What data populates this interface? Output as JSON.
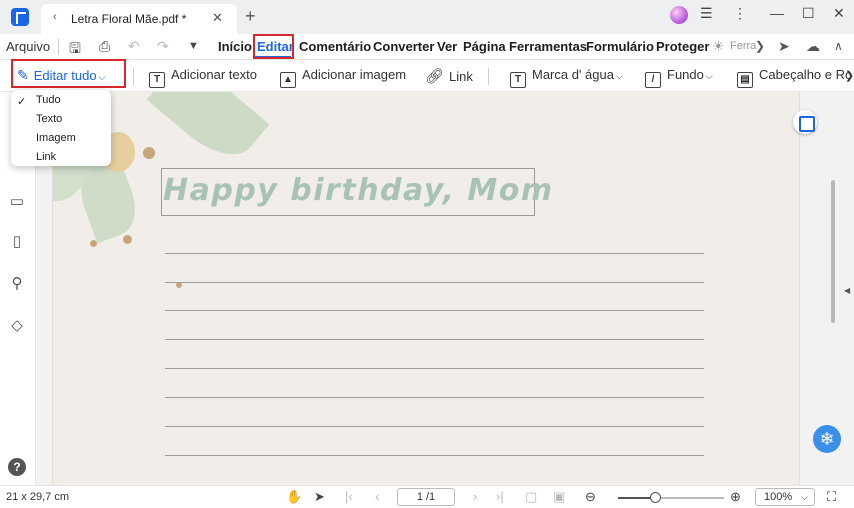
{
  "titlebar": {
    "tab_title": "Letra Floral Mãe.pdf *",
    "tab_close": "✕",
    "new_tab": "+",
    "window_controls": {
      "help": "☰",
      "more": "⋮",
      "minimize": "—",
      "maximize": "☐",
      "close": "✕"
    }
  },
  "menubar": {
    "file": "Arquivo",
    "items": [
      "Início",
      "Editar",
      "Comentário",
      "Converter",
      "Ver",
      "Página",
      "Ferramentas",
      "Formulário",
      "Proteger"
    ],
    "active": "Editar",
    "overflow_label": "Ferra"
  },
  "toolbar": {
    "edit_all": "Editar tudo",
    "add_text": "Adicionar texto",
    "add_image": "Adicionar imagem",
    "link": "Link",
    "watermark": "Marca d' água",
    "background": "Fundo",
    "header_footer": "Cabeçalho e Ro"
  },
  "dropdown": {
    "items": [
      "Tudo",
      "Texto",
      "Imagem",
      "Link"
    ],
    "selected": "Tudo"
  },
  "document": {
    "heading": "Happy birthday, Mom"
  },
  "statusbar": {
    "page_size": "21 x 29,7 cm",
    "page_indicator": "1 /1",
    "zoom_fraction": 0.35,
    "zoom_value": "100%"
  },
  "colors": {
    "accent": "#1a66e8",
    "highlight": "#d9272e",
    "heading_text": "#a8c2b4",
    "page_bg": "#f1eee9"
  },
  "icons": [
    "app-logo-icon",
    "print-icon",
    "undo-icon",
    "redo-icon",
    "save-icon",
    "thumbnail-icon",
    "comment-icon",
    "bookmark-icon",
    "search-icon",
    "layers-icon",
    "help-icon",
    "ai-assistant-icon",
    "fit-page-icon",
    "hand-tool-icon",
    "select-tool-icon",
    "zoom-out-icon",
    "zoom-in-icon"
  ]
}
